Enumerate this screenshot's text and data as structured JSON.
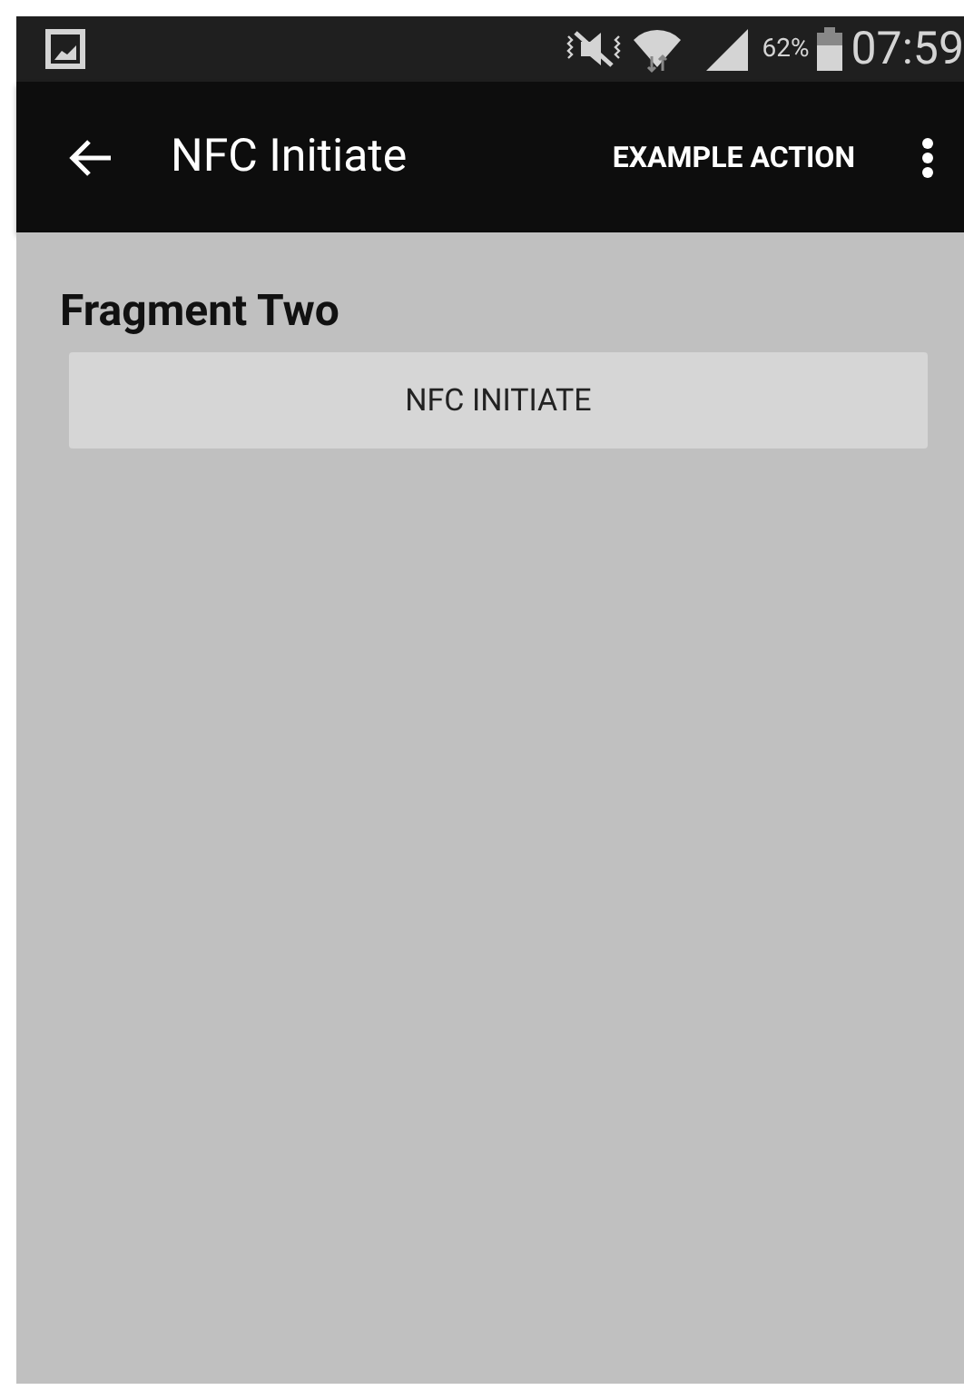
{
  "status_bar": {
    "battery_percent": "62%",
    "time": "07:59"
  },
  "toolbar": {
    "title": "NFC Initiate",
    "action": "EXAMPLE ACTION"
  },
  "content": {
    "heading": "Fragment Two",
    "button": "NFC INITIATE"
  }
}
